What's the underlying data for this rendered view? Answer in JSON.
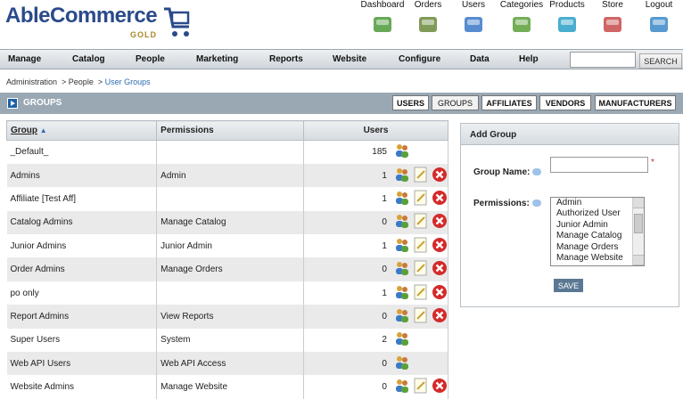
{
  "logo": {
    "text": "AbleCommerce",
    "edition": "GOLD"
  },
  "topnav": [
    {
      "label": "Dashboard",
      "icon": "dashboard-icon"
    },
    {
      "label": "Orders",
      "icon": "orders-truck-icon"
    },
    {
      "label": "Users",
      "icon": "users-icon"
    },
    {
      "label": "Categories",
      "icon": "categories-folder-icon"
    },
    {
      "label": "Products",
      "icon": "products-shirt-icon"
    },
    {
      "label": "Store",
      "icon": "store-basket-icon"
    },
    {
      "label": "Logout",
      "icon": "logout-lock-icon"
    }
  ],
  "menu": [
    "Manage",
    "Catalog",
    "People",
    "Marketing",
    "Reports",
    "Website",
    "Configure",
    "Data",
    "Help"
  ],
  "search": {
    "value": "",
    "button": "SEARCH"
  },
  "breadcrumb": {
    "a": "Administration",
    "b": "People",
    "c": "User Groups"
  },
  "section": {
    "title": "GROUPS"
  },
  "tabs": [
    "USERS",
    "GROUPS",
    "AFFILIATES",
    "VENDORS",
    "MANUFACTURERS"
  ],
  "table": {
    "headers": {
      "group": "Group",
      "permissions": "Permissions",
      "users": "Users"
    },
    "rows": [
      {
        "group": "_Default_",
        "permissions": "",
        "users": "185",
        "edit": false,
        "delete": false
      },
      {
        "group": "Admins",
        "permissions": "Admin",
        "users": "1",
        "edit": true,
        "delete": true
      },
      {
        "group": "Affiliate [Test Aff]",
        "permissions": "",
        "users": "1",
        "edit": true,
        "delete": true
      },
      {
        "group": "Catalog Admins",
        "permissions": "Manage Catalog",
        "users": "0",
        "edit": true,
        "delete": true
      },
      {
        "group": "Junior Admins",
        "permissions": "Junior Admin",
        "users": "1",
        "edit": true,
        "delete": true
      },
      {
        "group": "Order Admins",
        "permissions": "Manage Orders",
        "users": "0",
        "edit": true,
        "delete": true
      },
      {
        "group": "po only",
        "permissions": "",
        "users": "1",
        "edit": true,
        "delete": true
      },
      {
        "group": "Report Admins",
        "permissions": "View Reports",
        "users": "0",
        "edit": true,
        "delete": true
      },
      {
        "group": "Super Users",
        "permissions": "System",
        "users": "2",
        "edit": false,
        "delete": false
      },
      {
        "group": "Web API Users",
        "permissions": "Web API Access",
        "users": "0",
        "edit": false,
        "delete": false
      },
      {
        "group": "Website Admins",
        "permissions": "Manage Website",
        "users": "0",
        "edit": true,
        "delete": true
      }
    ]
  },
  "add_group": {
    "title": "Add Group",
    "name_label": "Group Name:",
    "name_value": "",
    "required_mark": "*",
    "perm_label": "Permissions:",
    "permissions": [
      "Admin",
      "Authorized User",
      "Junior Admin",
      "Manage Catalog",
      "Manage Orders",
      "Manage Website"
    ],
    "save": "SAVE"
  }
}
